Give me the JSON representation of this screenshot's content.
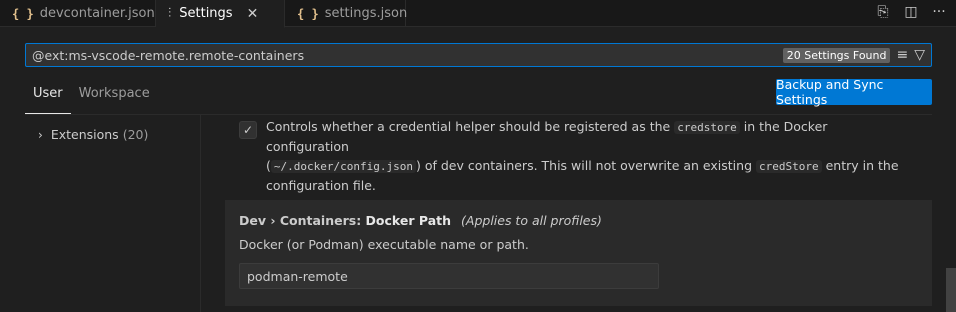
{
  "tabs": [
    {
      "label": "devcontainer.json",
      "icon": "json-braces-icon"
    },
    {
      "label": "Settings",
      "icon": "settings-sliders-icon",
      "active": true
    },
    {
      "label": "settings.json",
      "icon": "json-braces-icon"
    }
  ],
  "search": {
    "query": "@ext:ms-vscode-remote.remote-containers",
    "results_badge": "20 Settings Found"
  },
  "scopes": [
    {
      "label": "User",
      "active": true
    },
    {
      "label": "Workspace",
      "active": false
    }
  ],
  "sync_button": "Backup and Sync Settings",
  "toc": {
    "label": "Extensions",
    "count": "(20)"
  },
  "setting_credstore": {
    "line1_a": "Controls whether a credential helper should be registered as the",
    "line1_code": "credstore",
    "line1_b": "in the Docker configuration",
    "line2_a": "(",
    "line2_code": "~/.docker/config.json",
    "line2_b": ") of dev containers. This will not overwrite an existing",
    "line2_code2": "credStore",
    "line2_c": "entry in the",
    "line3": "configuration file.",
    "checked": true
  },
  "setting_docker_path": {
    "category": "Dev › Containers: ",
    "name": "Docker Path",
    "scope_note": "(Applies to all profiles)",
    "description": "Docker (or Podman) executable name or path.",
    "value": "podman-remote"
  },
  "colors": {
    "accent": "#0078d4",
    "background": "#1f1f1f"
  }
}
